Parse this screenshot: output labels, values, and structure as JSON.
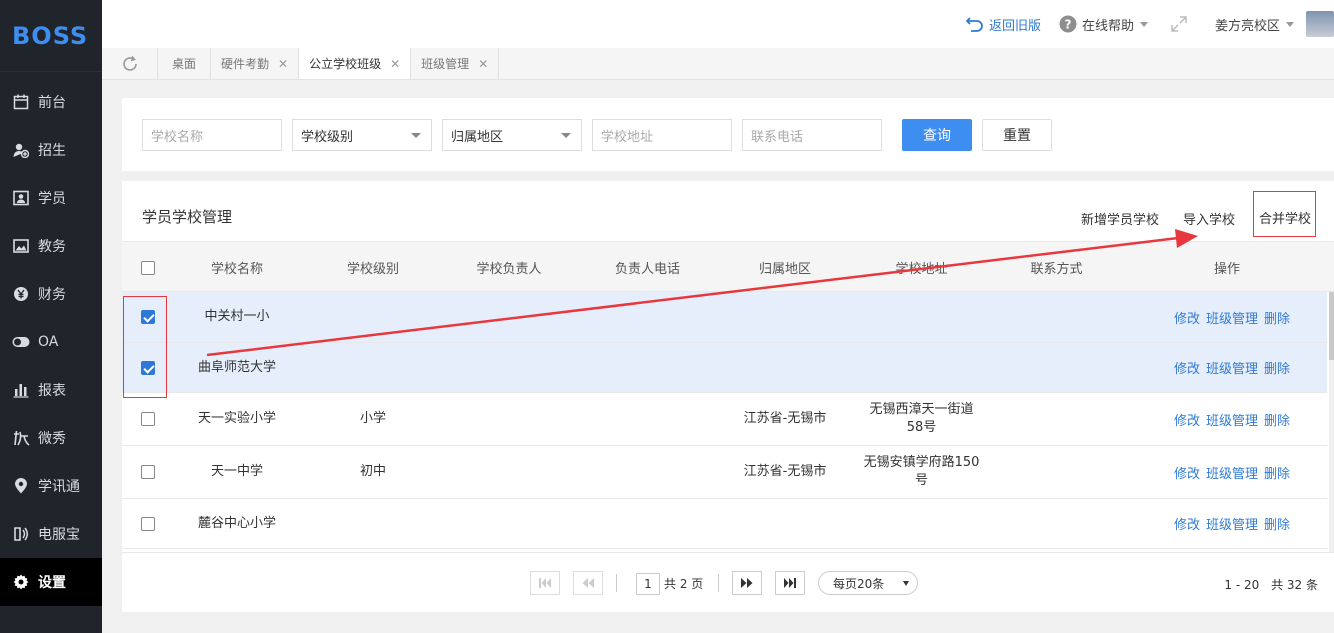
{
  "app": {
    "logo": "BOSS"
  },
  "sidebar": {
    "items": [
      {
        "label": "前台",
        "icon": "calendar-icon"
      },
      {
        "label": "招生",
        "icon": "user-add-icon"
      },
      {
        "label": "学员",
        "icon": "id-card-icon"
      },
      {
        "label": "教务",
        "icon": "image-icon"
      },
      {
        "label": "财务",
        "icon": "yen-coin-icon"
      },
      {
        "label": "OA",
        "icon": "toggle-icon"
      },
      {
        "label": "报表",
        "icon": "bar-chart-icon"
      },
      {
        "label": "微秀",
        "icon": "micro-show-icon"
      },
      {
        "label": "学讯通",
        "icon": "map-pin-icon"
      },
      {
        "label": "电服宝",
        "icon": "phone-service-icon"
      },
      {
        "label": "设置",
        "icon": "gear-icon",
        "active": true
      }
    ]
  },
  "topbar": {
    "back_old": "返回旧版",
    "help": "在线帮助",
    "campus": "姜方亮校区"
  },
  "tabs": [
    {
      "label": "桌面",
      "closable": false,
      "active": false
    },
    {
      "label": "硬件考勤",
      "closable": true,
      "active": false
    },
    {
      "label": "公立学校班级",
      "closable": true,
      "active": true
    },
    {
      "label": "班级管理",
      "closable": true,
      "active": false
    }
  ],
  "filter": {
    "school_name_placeholder": "学校名称",
    "school_level": "学校级别",
    "region": "归属地区",
    "address_placeholder": "学校地址",
    "phone_placeholder": "联系电话",
    "query_label": "查询",
    "reset_label": "重置"
  },
  "card": {
    "title": "学员学校管理",
    "actions": {
      "add": "新增学员学校",
      "import": "导入学校",
      "merge": "合并学校"
    }
  },
  "table": {
    "headers": [
      "学校名称",
      "学校级别",
      "学校负责人",
      "负责人电话",
      "归属地区",
      "学校地址",
      "联系方式",
      "操作"
    ],
    "ops": {
      "edit": "修改",
      "classes": "班级管理",
      "delete": "删除"
    },
    "rows": [
      {
        "name": "中关村一小",
        "level": "",
        "head": "",
        "head_phone": "",
        "region": "",
        "address": "",
        "contact": "",
        "checked": true
      },
      {
        "name": "曲阜师范大学",
        "level": "",
        "head": "",
        "head_phone": "",
        "region": "",
        "address": "",
        "contact": "",
        "checked": true
      },
      {
        "name": "天一实验小学",
        "level": "小学",
        "head": "",
        "head_phone": "",
        "region": "江苏省-无锡市",
        "address": "无锡西漳天一街道58号",
        "contact": "",
        "checked": false
      },
      {
        "name": "天一中学",
        "level": "初中",
        "head": "",
        "head_phone": "",
        "region": "江苏省-无锡市",
        "address": "无锡安镇学府路150号",
        "contact": "",
        "checked": false
      },
      {
        "name": "麓谷中心小学",
        "level": "",
        "head": "",
        "head_phone": "",
        "region": "",
        "address": "",
        "contact": "",
        "checked": false
      }
    ]
  },
  "pagination": {
    "current_page": "1",
    "total_pages": "共 2 页",
    "page_size": "每页20条",
    "range": "1 - 20",
    "total": "共 32 条"
  },
  "colors": {
    "accent": "#3d8ef0",
    "link": "#2f7ad6",
    "annotation": "#e8383d",
    "sidebar": "#20242b"
  }
}
